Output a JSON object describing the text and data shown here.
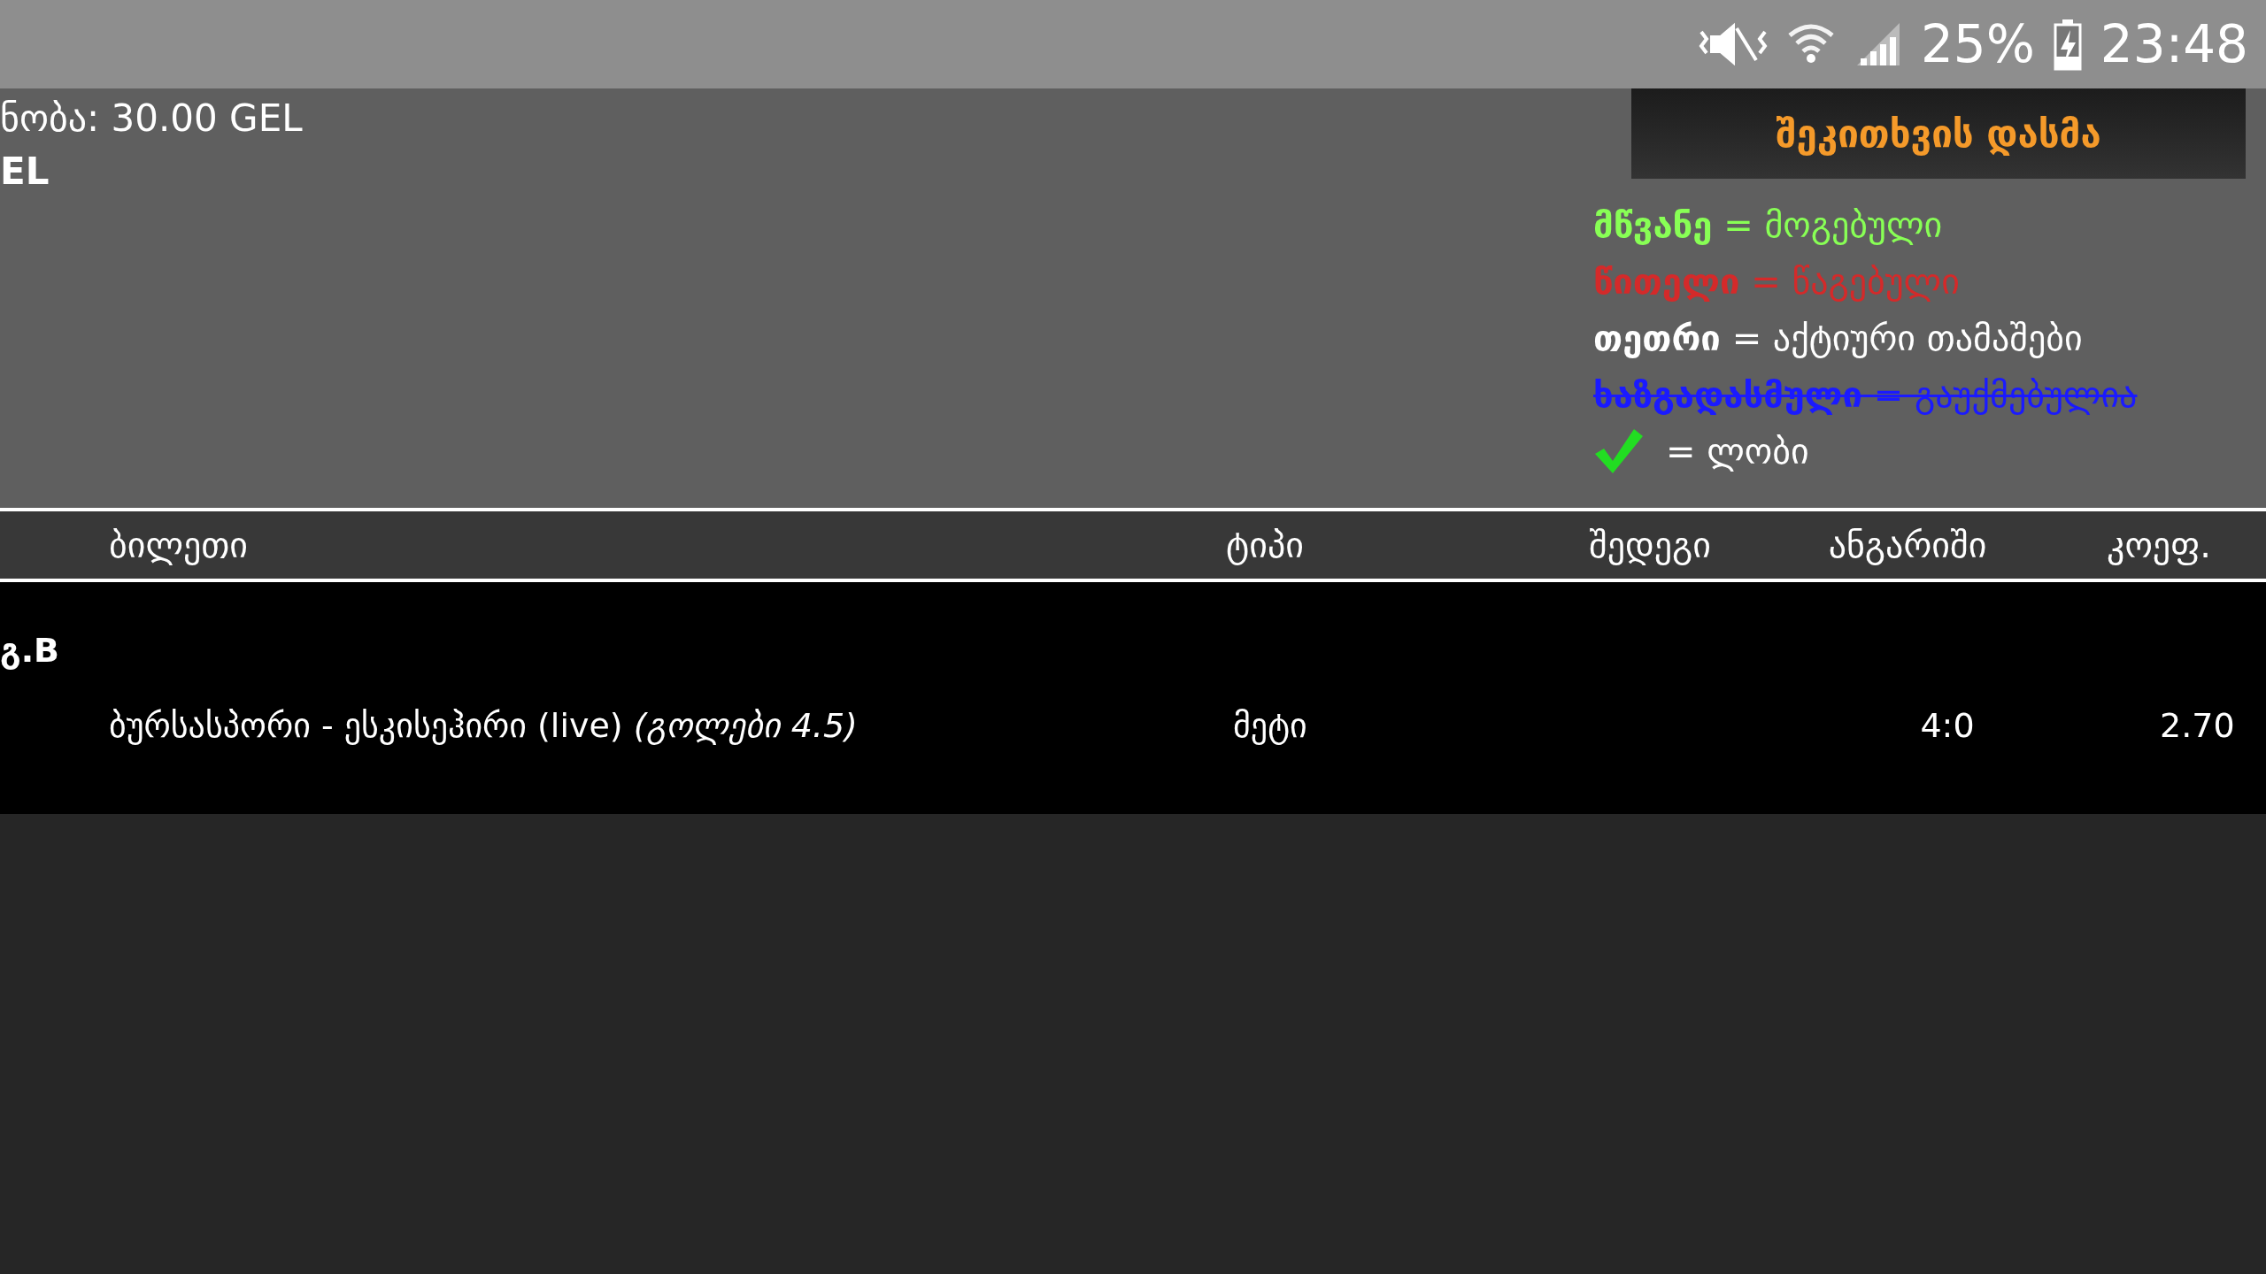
{
  "status_bar": {
    "battery": "25%",
    "time": "23:48"
  },
  "summary": {
    "lines": [
      "ნობა: 30.00 GEL",
      "EL"
    ]
  },
  "hide_button": {
    "label": "შეკითხვის დასმა"
  },
  "legend": [
    {
      "kind": "text",
      "term": "მწვანე",
      "meaning": "= მოგებული",
      "color": "#88ff55",
      "struck": false
    },
    {
      "kind": "text",
      "term": "წითელი",
      "meaning": "= წაგებული",
      "color": "#d42a2a",
      "struck": false
    },
    {
      "kind": "text",
      "term": "თეთრი",
      "meaning": "= აქტიური თამაშები",
      "color": "#ffffff",
      "struck": false
    },
    {
      "kind": "text",
      "term": "ხაზგადასმული",
      "meaning": "= გაუქმებულია",
      "color": "#1a1aff",
      "struck": true
    },
    {
      "kind": "check",
      "meaning": "= ლობი",
      "color": "#ffffff",
      "struck": false
    }
  ],
  "table": {
    "columns": [
      "ბილეთი",
      "ტიპი",
      "შედეგი",
      "ანგარიში",
      "კოეფ."
    ],
    "group": "გ.B",
    "rows": [
      {
        "match": "ბურსასპორი - ესკისეჰირი (live) *(გოლები 4.5)*",
        "type": "მეტი",
        "score": "4:0",
        "odds": "2.70"
      }
    ]
  }
}
